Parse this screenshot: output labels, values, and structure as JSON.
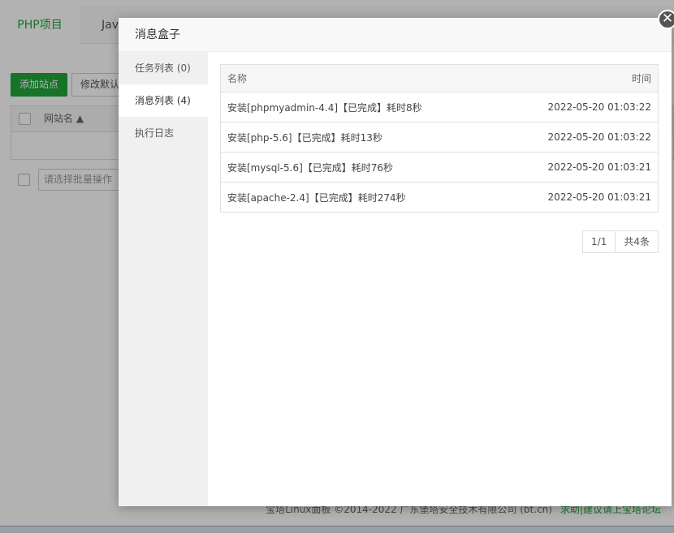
{
  "background": {
    "tabs": [
      {
        "label": "PHP项目"
      },
      {
        "label": "Java"
      }
    ],
    "add_site_label": "添加站点",
    "modify_default_label": "修改默认",
    "table_header_site_name": "网站名 ▲",
    "batch_placeholder": "请选择批量操作",
    "footer_text": "宝塔Linux面板 ©2014-2022 广东堡塔安全技术有限公司 (bt.cn)",
    "footer_link": "求助|建议请上宝塔论坛"
  },
  "dialog": {
    "title": "消息盒子",
    "close_glyph": "✕",
    "sidebar": [
      {
        "label": "任务列表 (0)"
      },
      {
        "label": "消息列表 (4)"
      },
      {
        "label": "执行日志"
      }
    ],
    "table": {
      "col_name": "名称",
      "col_time": "时间",
      "rows": [
        {
          "name": "安装[phpmyadmin-4.4]【已完成】耗时8秒",
          "time": "2022-05-20 01:03:22"
        },
        {
          "name": "安装[php-5.6]【已完成】耗时13秒",
          "time": "2022-05-20 01:03:22"
        },
        {
          "name": "安装[mysql-5.6]【已完成】耗时76秒",
          "time": "2022-05-20 01:03:21"
        },
        {
          "name": "安装[apache-2.4]【已完成】耗时274秒",
          "time": "2022-05-20 01:03:21"
        }
      ]
    },
    "pager": {
      "page": "1/1",
      "total": "共4条"
    }
  },
  "colors": {
    "accent": "#20a53a"
  }
}
